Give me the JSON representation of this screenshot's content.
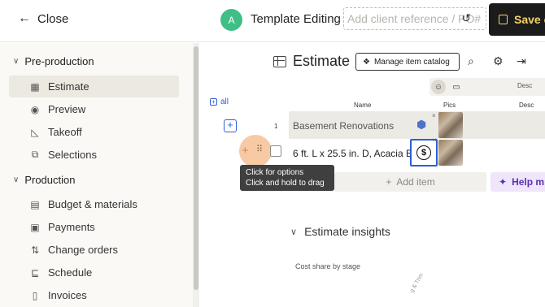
{
  "topbar": {
    "close_label": "Close",
    "avatar_initial": "A",
    "template_title": "Template Editing",
    "client_ref_placeholder": "Add client reference / PO#",
    "save_label": "Save e"
  },
  "sidebar": {
    "sections": [
      {
        "label": "Pre-production",
        "items": [
          {
            "label": "Estimate",
            "icon": "table-icon",
            "active": true
          },
          {
            "label": "Preview",
            "icon": "eye-icon"
          },
          {
            "label": "Takeoff",
            "icon": "ruler-triangle-icon"
          },
          {
            "label": "Selections",
            "icon": "selections-icon"
          }
        ]
      },
      {
        "label": "Production",
        "items": [
          {
            "label": "Budget & materials",
            "icon": "calculator-icon"
          },
          {
            "label": "Payments",
            "icon": "money-icon"
          },
          {
            "label": "Change orders",
            "icon": "change-orders-icon"
          },
          {
            "label": "Schedule",
            "icon": "schedule-icon"
          },
          {
            "label": "Invoices",
            "icon": "invoice-icon"
          }
        ]
      }
    ]
  },
  "estimate": {
    "title": "Estimate",
    "catalog_label": "Manage item catalog",
    "all_label": "all",
    "columns": {
      "name": "Name",
      "pics": "Pics",
      "desc": "Desc"
    },
    "toggle_desc": "Desc",
    "row_number": "1",
    "group_name": "Basement Renovations",
    "item_name": "6 ft. L x 25.5 in. D, Acacia B",
    "tooltip_line1": "Click for options",
    "tooltip_line2": "Click and hold to drag",
    "add_item_label": "Add item",
    "help_label": "Help m",
    "insights_title": "Estimate insights",
    "cost_share_label": "Cost share by stage",
    "axis_label": "g & Trim"
  },
  "colors": {
    "accent": "#2b5fd9",
    "avatar": "#3fbf86",
    "save_bg": "#1b1b1b",
    "save_text": "#f5d36a",
    "help": "#5b2fb1"
  }
}
